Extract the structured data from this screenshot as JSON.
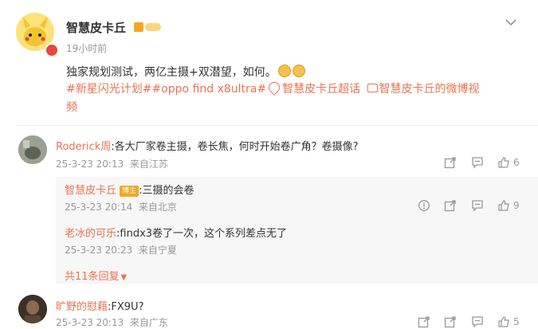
{
  "post": {
    "author": "智慧皮卡丘",
    "time": "19小时前",
    "text": "独家规划测试，两亿主摄+双潜望，如何。",
    "tags_line1": "#新星闪光计划##oppo find x8ultra#",
    "superchat": "智慧皮卡丘超话",
    "video_link": "智慧皮卡丘的微博视",
    "tags_line2": "频"
  },
  "comments": [
    {
      "author": "Roderick周",
      "text": ":各大厂家卷主摄，卷长焦，何时开始卷广角？卷摄像?",
      "date": "25-3-23 20:13",
      "location": "来自江苏",
      "likes": "6"
    },
    {
      "author": "旷野的慰藉",
      "text": ":FX9U?",
      "date": "25-3-23 20:13",
      "location": "来自广东",
      "likes": "5"
    }
  ],
  "replies": [
    {
      "author": "智慧皮卡丘",
      "badge": "博主",
      "text": ":三摄的会卷",
      "date": "25-3-23 20:14",
      "location": "来自北京",
      "likes": "9"
    },
    {
      "author": "老冰的可乐",
      "text": ":findx3卷了一次，这个系列差点无了",
      "date": "25-3-23 20:23",
      "location": "来自宁夏"
    }
  ],
  "more_replies": "共11条回复",
  "colors": {
    "accent": "#eb7350",
    "muted": "#999999"
  }
}
